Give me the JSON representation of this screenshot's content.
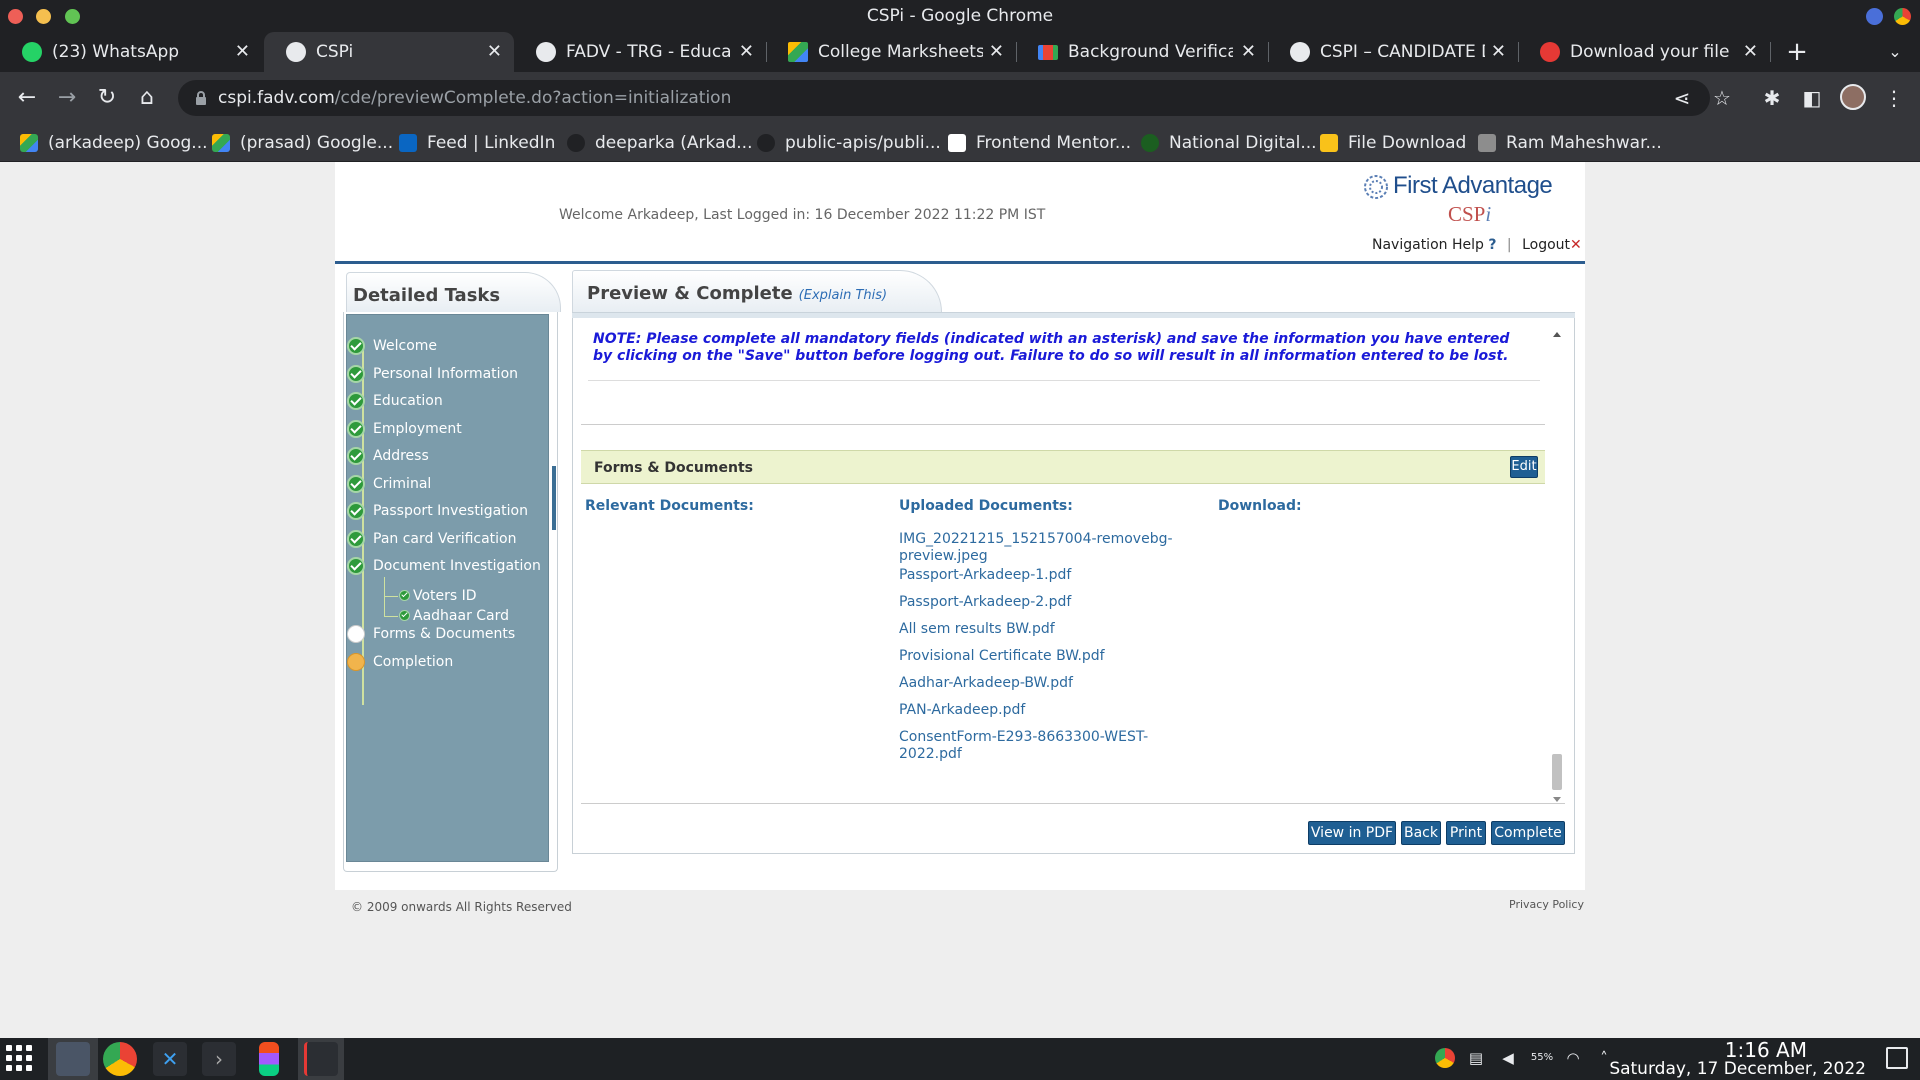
{
  "window": {
    "title": "CSPi - Google Chrome"
  },
  "tabs": [
    {
      "label": "(23) WhatsApp",
      "icon": "whatsapp-icon",
      "active": false
    },
    {
      "label": "CSPi",
      "icon": "globe-icon",
      "active": true
    },
    {
      "label": "FADV - TRG - Educatio",
      "icon": "globe-icon",
      "active": false
    },
    {
      "label": "College Marksheets -",
      "icon": "google-drive-icon",
      "active": false
    },
    {
      "label": "Background Verificatio",
      "icon": "gmail-icon",
      "active": false
    },
    {
      "label": "CSPI – CANDIDATE DA",
      "icon": "globe-icon",
      "active": false
    },
    {
      "label": "Download your file —",
      "icon": "download-site-icon",
      "active": false
    }
  ],
  "address_bar": {
    "domain": "cspi.fadv.com",
    "path": "/cde/previewComplete.do?action=initialization"
  },
  "bookmarks": [
    {
      "label": "(arkadeep) Goog...",
      "icon": "google-drive-icon"
    },
    {
      "label": "(prasad) Google...",
      "icon": "google-drive-icon"
    },
    {
      "label": "Feed | LinkedIn",
      "icon": "linkedin-icon"
    },
    {
      "label": "deeparka (Arkad...",
      "icon": "github-icon"
    },
    {
      "label": "public-apis/publi...",
      "icon": "github-icon"
    },
    {
      "label": "Frontend Mentor...",
      "icon": "frontend-mentor-icon"
    },
    {
      "label": "National Digital...",
      "icon": "globe-icon"
    },
    {
      "label": "File Download",
      "icon": "file-download-icon"
    },
    {
      "label": "Ram Maheshwar...",
      "icon": "person-icon"
    }
  ],
  "header": {
    "welcome": "Welcome Arkadeep, Last Logged in: 16 December 2022 11:22 PM IST",
    "logo_text": "First Advantage",
    "logo_sub": "CSP",
    "logo_sub_i": "i",
    "nav_help": "Navigation Help",
    "nav_help_mark": "?",
    "separator": "|",
    "logout": "Logout",
    "logout_mark": "✕"
  },
  "sidebar": {
    "title": "Detailed Tasks",
    "tasks": [
      {
        "label": "Welcome",
        "status": "complete"
      },
      {
        "label": "Personal Information",
        "status": "complete"
      },
      {
        "label": "Education",
        "status": "complete"
      },
      {
        "label": "Employment",
        "status": "complete"
      },
      {
        "label": "Address",
        "status": "complete"
      },
      {
        "label": "Criminal",
        "status": "complete"
      },
      {
        "label": "Passport Investigation",
        "status": "complete"
      },
      {
        "label": "Pan card Verification",
        "status": "complete"
      },
      {
        "label": "Document Investigation",
        "status": "complete"
      },
      {
        "label": "Forms & Documents",
        "status": "current"
      },
      {
        "label": "Completion",
        "status": "pending"
      }
    ],
    "subtasks": [
      {
        "label": "Voters ID",
        "status": "complete"
      },
      {
        "label": "Aadhaar Card",
        "status": "complete"
      }
    ]
  },
  "main": {
    "title": "Preview & Complete",
    "explain": "(Explain This)",
    "note": "NOTE: Please complete all mandatory fields (indicated with an asterisk) and save the information you have entered by clicking on the \"Save\" button before logging out. Failure to do so will result in all information entered to be lost.",
    "section_title": "Forms & Documents",
    "edit_label": "Edit",
    "columns": {
      "relevant": "Relevant Documents:",
      "uploaded": "Uploaded Documents:",
      "download": "Download:"
    },
    "uploaded_documents": [
      "IMG_20221215_152157004-removebg-preview.jpeg",
      "Passport-Arkadeep-1.pdf",
      "Passport-Arkadeep-2.pdf",
      "All sem results BW.pdf",
      "Provisional Certificate BW.pdf",
      "Aadhar-Arkadeep-BW.pdf",
      "PAN-Arkadeep.pdf",
      "ConsentForm-E293-8663300-WEST-2022.pdf"
    ],
    "actions": {
      "view_pdf": "View in PDF",
      "back": "Back",
      "print": "Print",
      "complete": "Complete"
    }
  },
  "footer": {
    "copyright": "© 2009 onwards All Rights Reserved",
    "privacy": "Privacy Policy"
  },
  "taskbar": {
    "time": "1:16 AM",
    "date": "Saturday, 17 December, 2022",
    "battery": "55%"
  }
}
